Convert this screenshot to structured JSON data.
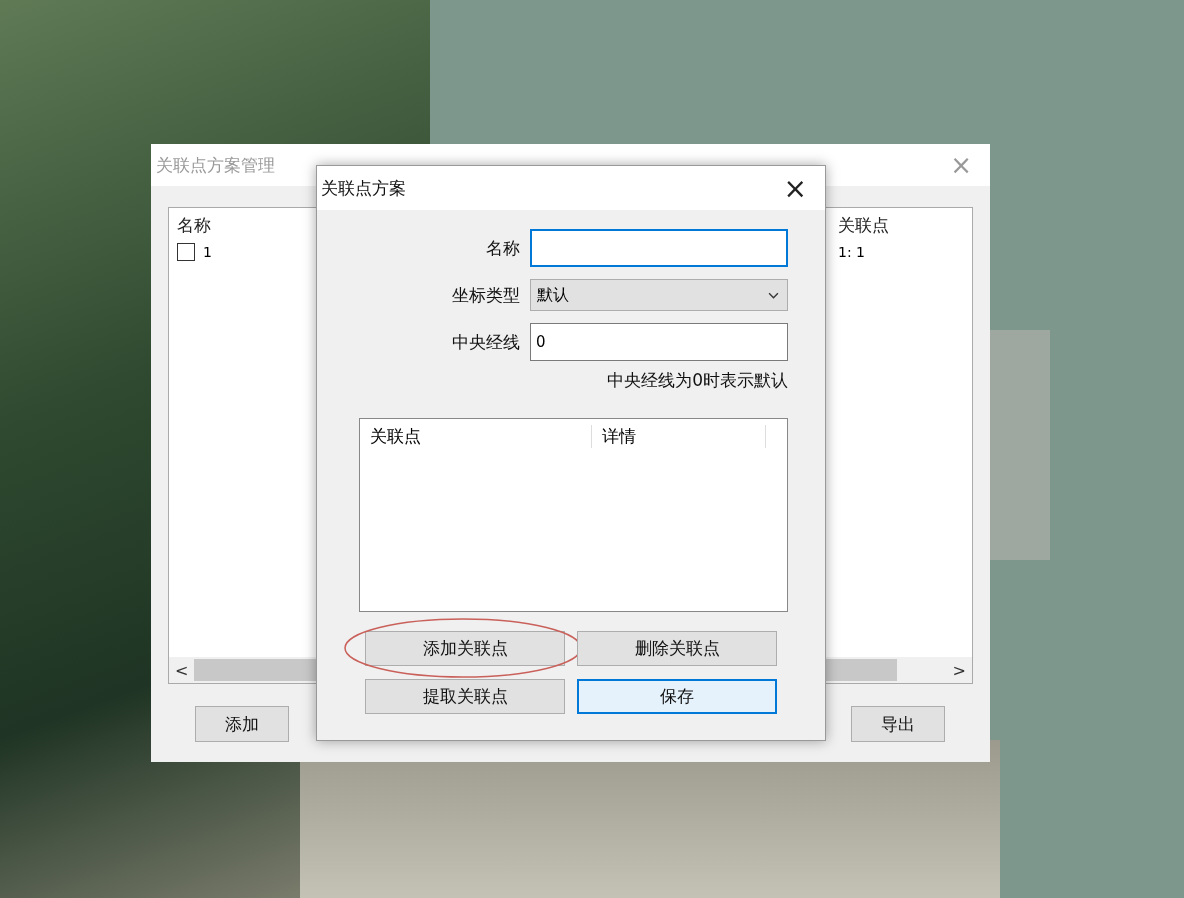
{
  "back_window": {
    "title": "关联点方案管理",
    "active": false,
    "columns": [
      "名称",
      "关联点"
    ],
    "rows": [
      {
        "name": "1",
        "checked": false,
        "points": "1: 1"
      }
    ],
    "scroll_left": "<",
    "scroll_right": ">",
    "buttons": [
      {
        "label": "添加"
      },
      {
        "label": "导出"
      }
    ]
  },
  "dialog": {
    "title": "关联点方案",
    "active": true,
    "close": "×",
    "fields": [
      {
        "kind": "input",
        "label": "名称",
        "focused": true
      },
      {
        "kind": "select",
        "label": "坐标类型",
        "value": "默认",
        "focused": false
      },
      {
        "kind": "input",
        "label": "中央经线",
        "value": "0",
        "focused": false
      }
    ],
    "hint": "中央经线为0时表示默认",
    "table": {
      "columns": [
        "关联点",
        "详情"
      ]
    },
    "buttons": [
      {
        "label": "添加关联点",
        "default": false,
        "circled": true
      },
      {
        "label": "删除关联点",
        "default": false,
        "circled": false
      },
      {
        "label": "提取关联点",
        "default": false,
        "circled": false
      },
      {
        "label": "保存",
        "default": true,
        "circled": false
      }
    ]
  }
}
